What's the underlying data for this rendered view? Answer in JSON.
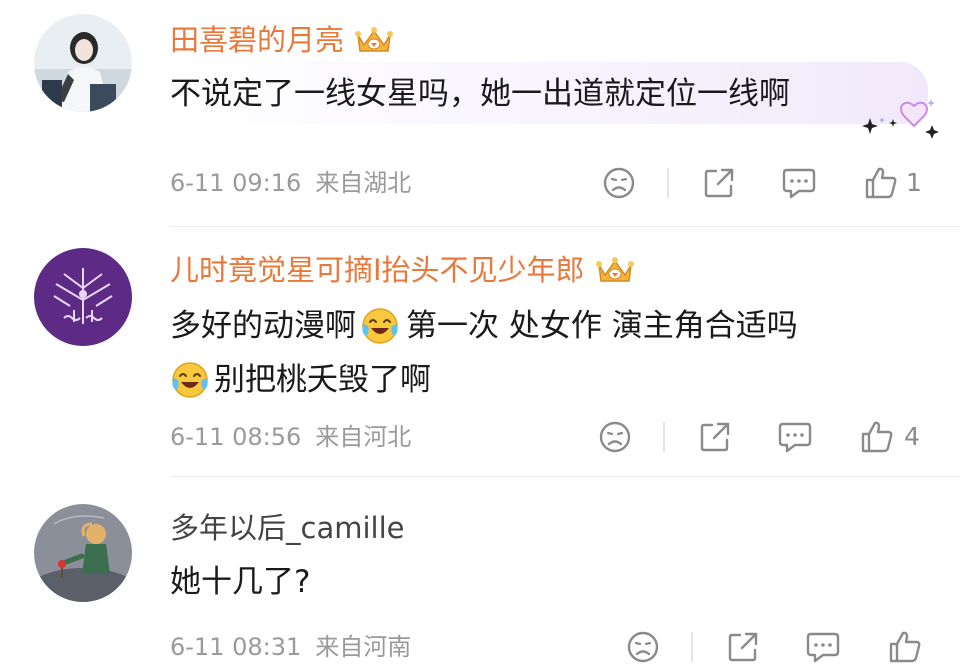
{
  "comments": [
    {
      "username": "田喜碧的月亮",
      "text_lines": [
        "不说定了一线女星吗，她一出道就定位一线啊"
      ],
      "date": "6-11 09:16",
      "location": "来自湖北",
      "likes": "1",
      "username_color": "#e8793a",
      "badge": "crown-badge-icon",
      "highlighted": true
    },
    {
      "username": "儿时竟觉星可摘I抬头不见少年郎",
      "line1_part1": "多好的动漫啊",
      "line1_part2": "第一次 处女作 演主角合适吗",
      "line2": "别把桃夭毁了啊",
      "emoji": "laugh-cry-emoji",
      "date": "6-11 08:56",
      "location": "来自河北",
      "likes": "4",
      "username_color": "#e8793a",
      "badge": "crown-badge-icon"
    },
    {
      "username": "多年以后_camille",
      "text_lines": [
        "她十几了?"
      ],
      "date": "6-11 08:31",
      "location": "来自河南",
      "likes": "",
      "username_color": "#444444"
    }
  ],
  "actions": [
    "dislike-icon",
    "share-icon",
    "reply-icon",
    "like-icon"
  ],
  "colors": {
    "accent_orange": "#e8793a",
    "meta_gray": "#9a9a9a",
    "bubble_purple": "#f1e9fb",
    "icon_gray": "#8a8a8a"
  }
}
